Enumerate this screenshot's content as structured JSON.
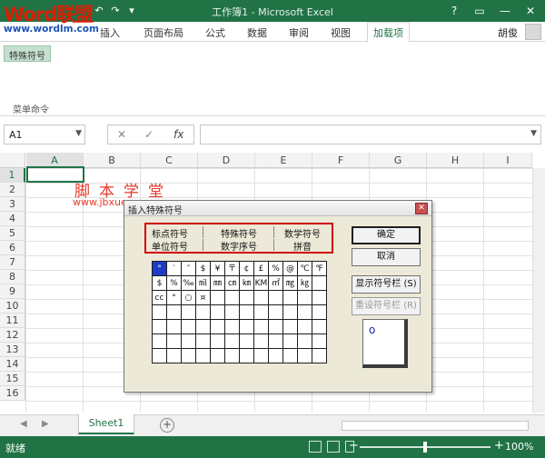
{
  "window": {
    "title": "工作簿1 - Microsoft Excel",
    "controls": {
      "help": "?",
      "restore": "▭",
      "minimize": "—",
      "maximize": "□",
      "close": "✕"
    }
  },
  "logo": {
    "text": "Word联盟",
    "url": "www.wordlm.com"
  },
  "quick_access": {
    "undo": "↶",
    "redo": "↷",
    "more": "▾"
  },
  "ribbon": {
    "tabs": [
      "插入",
      "页面布局",
      "公式",
      "数据",
      "审阅",
      "视图",
      "加载项"
    ],
    "active_tab": "加载项",
    "user": "胡俊",
    "button_label": "特殊符号",
    "group_label": "菜单命令"
  },
  "formula_bar": {
    "name_box": "A1",
    "cancel": "✕",
    "enter": "✓",
    "fx": "fx",
    "value": ""
  },
  "grid": {
    "columns": [
      "A",
      "B",
      "C",
      "D",
      "E",
      "F",
      "G",
      "H",
      "I"
    ],
    "rows": [
      "1",
      "2",
      "3",
      "4",
      "5",
      "6",
      "7",
      "8",
      "9",
      "10",
      "11",
      "12",
      "13",
      "14",
      "15",
      "16"
    ],
    "active_cell": "A1"
  },
  "watermark": {
    "text": "脚本学堂",
    "url": "www.jbxue.com"
  },
  "dialog": {
    "title": "插入特殊符号",
    "close": "✕",
    "categories_row1": [
      "标点符号",
      "特殊符号",
      "数学符号"
    ],
    "categories_row2": [
      "单位符号",
      "数字序号",
      "拼音"
    ],
    "buttons": {
      "ok": "确定",
      "cancel": "取消",
      "show_toolbar": "显示符号栏 (S)",
      "reset_toolbar": "重设符号栏 (R)"
    },
    "symbols": [
      [
        "°",
        "′",
        "″",
        "$",
        "¥",
        "〒",
        "¢",
        "£",
        "%",
        "@",
        "℃",
        "℉"
      ],
      [
        "$",
        "%",
        "‰",
        "㏕",
        "㎜",
        "㎝",
        "㎞",
        "KM",
        "㎡",
        "㎎",
        "㎏",
        ""
      ],
      [
        "cc",
        "°",
        "○",
        "¤",
        "",
        "",
        "",
        "",
        "",
        "",
        "",
        ""
      ],
      [
        "",
        "",
        "",
        "",
        "",
        "",
        "",
        "",
        "",
        "",
        "",
        ""
      ],
      [
        "",
        "",
        "",
        "",
        "",
        "",
        "",
        "",
        "",
        "",
        "",
        ""
      ],
      [
        "",
        "",
        "",
        "",
        "",
        "",
        "",
        "",
        "",
        "",
        "",
        ""
      ],
      [
        "",
        "",
        "",
        "",
        "",
        "",
        "",
        "",
        "",
        "",
        "",
        ""
      ]
    ],
    "preview": "o"
  },
  "sheets": {
    "tabs": [
      "Sheet1"
    ],
    "active": "Sheet1",
    "add": "+"
  },
  "status": {
    "text": "就绪",
    "zoom": "100%",
    "zoom_fraction": 0.5
  },
  "colors": {
    "accent": "#217346",
    "highlight": "#d10000",
    "selected_symbol": "#1c3cc7"
  }
}
